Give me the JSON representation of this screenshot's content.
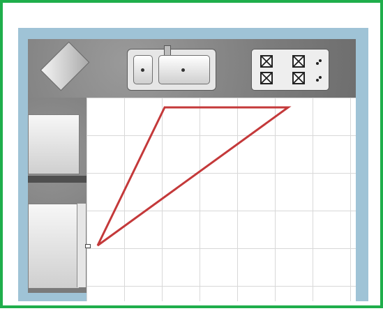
{
  "diagram": {
    "colors": {
      "frame_border": "#1fae4b",
      "plan_background": "#9fc3d6",
      "countertop": "#7d7d7d",
      "floor_tile": "#ffffff",
      "grid_line": "#d8d8d8",
      "work_triangle": "#c4393a"
    },
    "elements": {
      "refrigerator": "refrigerator-icon",
      "sink": "double-sink-icon",
      "stove": "four-burner-stove-icon",
      "cabinets": "cabinet-icon"
    }
  }
}
